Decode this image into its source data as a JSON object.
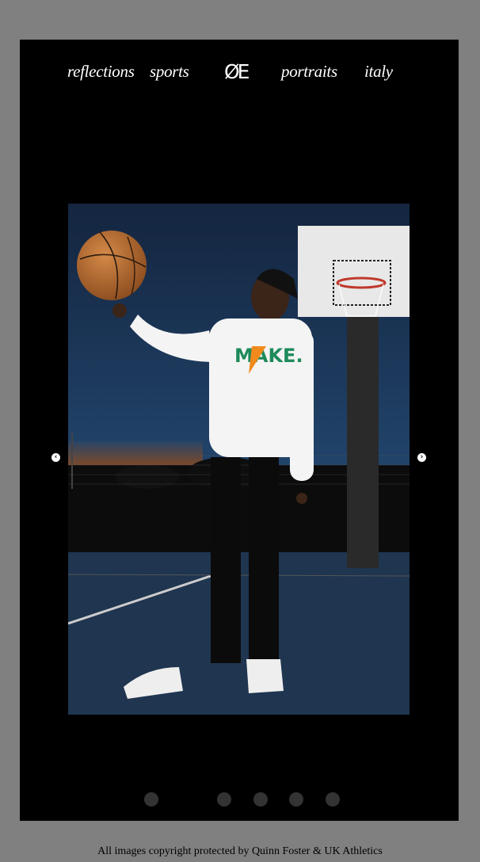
{
  "nav": {
    "items": [
      {
        "label": "reflections"
      },
      {
        "label": "sports"
      },
      {
        "label": "ØE"
      },
      {
        "label": "portraits"
      },
      {
        "label": "italy"
      }
    ]
  },
  "slideshow": {
    "prev_icon": "chevron-left-icon",
    "next_icon": "chevron-right-icon",
    "prev_glyph": "‹",
    "next_glyph": "›",
    "slide_count": 5,
    "photo_hoodie_text": "MAKE."
  },
  "colors": {
    "page_background": "#808080",
    "frame_background": "#000000",
    "dot": "#333333"
  },
  "footer": {
    "copyright": "All images copyright protected by Quinn Foster & UK Athletics"
  }
}
